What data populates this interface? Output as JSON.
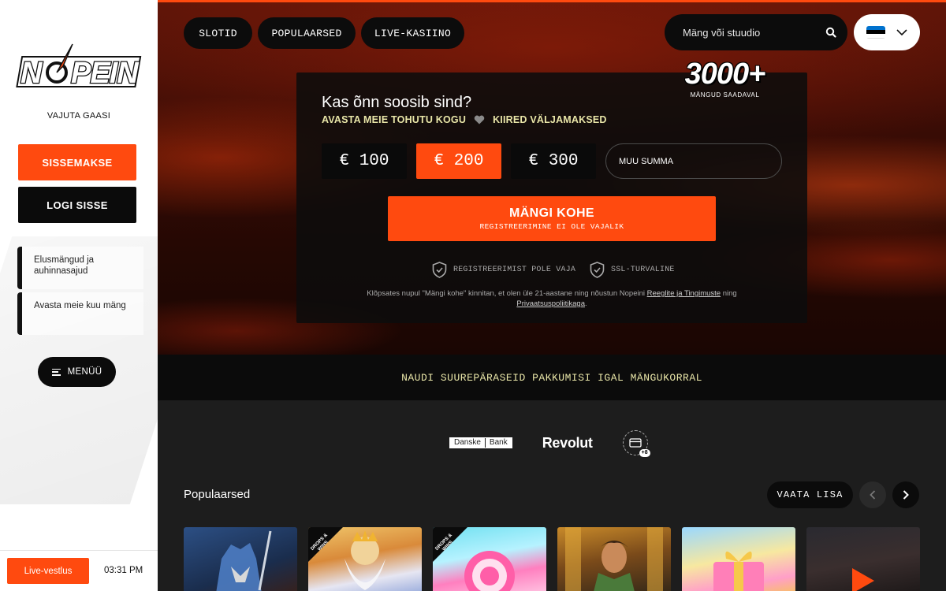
{
  "sidebar": {
    "logo_text": "NOPEIN",
    "tagline": "VAJUTA GAASI",
    "deposit_label": "SISSEMAKSE",
    "login_label": "LOGI SISSE",
    "promos": [
      {
        "label": "Elusmängud ja auhinnasajud"
      },
      {
        "label": "Avasta meie kuu mäng"
      }
    ],
    "menu_label": "MENÜÜ",
    "chat_label": "Live-vestlus",
    "time": "03:31 PM"
  },
  "nav": {
    "tabs": [
      {
        "label": "SLOTID"
      },
      {
        "label": "POPULAARSED"
      },
      {
        "label": "LIVE-KASIINO"
      }
    ],
    "search_placeholder": "Mäng või stuudio",
    "language_flag": "estonia-flag"
  },
  "hero": {
    "games_count": "3000+",
    "games_count_label": "MÄNGUD SAADAVAL",
    "title": "Kas õnn soosib sind?",
    "subtitle_left": "AVASTA MEIE TOHUTU KOGU",
    "subtitle_right": "KIIRED VÄLJAMAKSED",
    "amounts": [
      {
        "label": "€ 100",
        "selected": false
      },
      {
        "label": "€ 200",
        "selected": true
      },
      {
        "label": "€ 300",
        "selected": false
      }
    ],
    "custom_amount_placeholder": "MUU SUMMA",
    "play_label": "MÄNGI KOHE",
    "play_sublabel": "REGISTREERIMINE EI OLE VAJALIK",
    "trust": [
      {
        "label": "REGISTREERIMIST POLE VAJA"
      },
      {
        "label": "SSL-TURVALINE"
      }
    ],
    "legal_prefix": "Klõpsates nupul \"Mängi kohe\" kinnitan, et olen üle 21-aastane ning nõustun Nopeini ",
    "legal_terms_link": "Reeglite ja Tingimuste",
    "legal_mid": " ning ",
    "legal_privacy_link": "Privaatsuspoliitikaga",
    "legal_suffix": "."
  },
  "banner": {
    "text": "NAUDI SUUREPÄRASEID PAKKUMISI IGAL MÄNGUKORRAL"
  },
  "payments": {
    "danske_part1": "Danske",
    "danske_part2": "Bank",
    "revolut": "Revolut",
    "more_badge": "+8"
  },
  "popular": {
    "title": "Populaarsed",
    "view_more_label": "VAATA LISA",
    "drops_label": "DROPS & WINS",
    "games": [
      {
        "icon": "werewolf-art",
        "drops": false
      },
      {
        "icon": "zeus-art",
        "drops": true
      },
      {
        "icon": "candy-art",
        "drops": true
      },
      {
        "icon": "explorer-art",
        "drops": false
      },
      {
        "icon": "gift-art",
        "drops": false
      },
      {
        "icon": "play-art",
        "drops": false
      }
    ]
  },
  "colors": {
    "accent": "#ff4a0f",
    "highlight_text": "#e9e6a8",
    "dark": "#0b0b0b"
  }
}
